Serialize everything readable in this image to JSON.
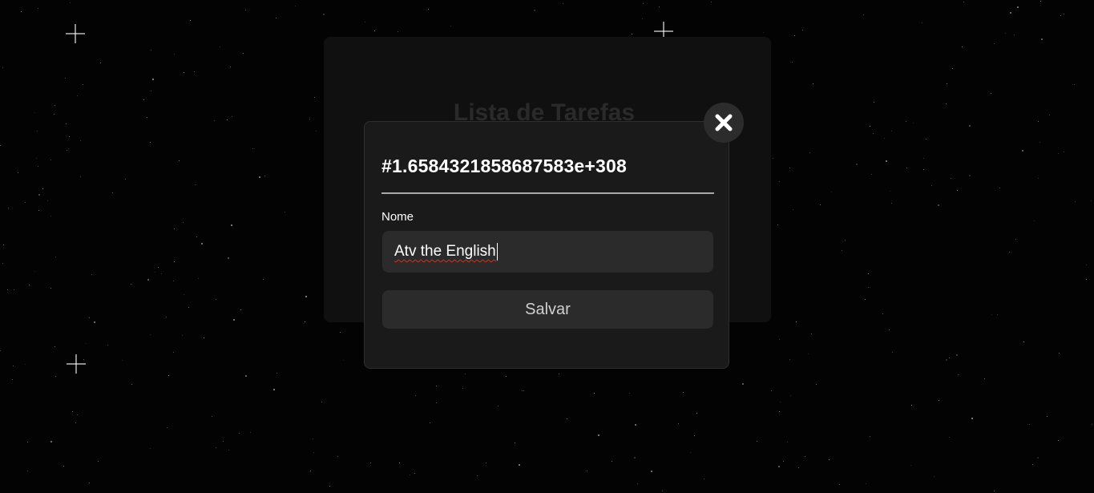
{
  "background": {
    "title": "Lista de Tarefas"
  },
  "modal": {
    "title": "#1.6584321858687583e+308",
    "name_label": "Nome",
    "name_value": "Atv the English",
    "save_label": "Salvar",
    "close_icon": "close-x-icon"
  },
  "colors": {
    "page_background": "#030303",
    "modal_background": "#1a1a1a",
    "field_background": "#2b2b2b",
    "divider": "#a9a9a9",
    "spellcheck_underline": "#c0392b"
  }
}
